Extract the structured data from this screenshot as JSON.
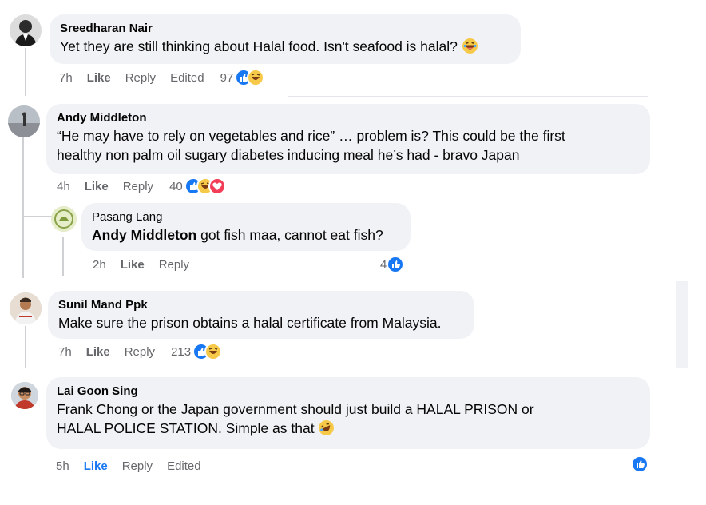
{
  "comments": [
    {
      "author": "Sreedharan Nair",
      "text": "Yet they are still thinking about Halal food. Isn't seafood is halal?",
      "time": "7h",
      "like": "Like",
      "reply": "Reply",
      "edited": "Edited",
      "reaction_count": "97",
      "reactions": [
        "like-icon",
        "haha-icon"
      ]
    },
    {
      "author": "Andy Middleton",
      "text_line1": "“He may have to rely on vegetables and rice” … problem is? This could be the first",
      "text_line2": "healthy non palm oil sugary diabetes inducing meal he’s had - bravo Japan",
      "time": "4h",
      "like": "Like",
      "reply": "Reply",
      "reaction_count": "40",
      "reactions": [
        "like-icon",
        "haha-icon",
        "love-icon"
      ]
    },
    {
      "author": "Pasang Lang",
      "mention": "Andy Middleton",
      "text": " got fish maa, cannot eat fish?",
      "time": "2h",
      "like": "Like",
      "reply": "Reply",
      "reaction_count": "4",
      "reactions": [
        "like-icon"
      ]
    },
    {
      "author": "Sunil Mand Ppk",
      "text": "Make sure the prison obtains a halal certificate from Malaysia.",
      "time": "7h",
      "like": "Like",
      "reply": "Reply",
      "reaction_count": "213",
      "reactions": [
        "like-icon",
        "haha-icon"
      ]
    },
    {
      "author": "Lai Goon Sing",
      "text_line1": "Frank Chong or the Japan government should just build a HALAL PRISON or",
      "text_line2": "HALAL POLICE STATION. Simple as that",
      "time": "5h",
      "like": "Like",
      "reply": "Reply",
      "edited": "Edited",
      "reactions": [
        "like-icon"
      ]
    }
  ],
  "colors": {
    "bubble": "#f0f2f5",
    "secondary_text": "#65676b",
    "accent": "#1877f2"
  }
}
